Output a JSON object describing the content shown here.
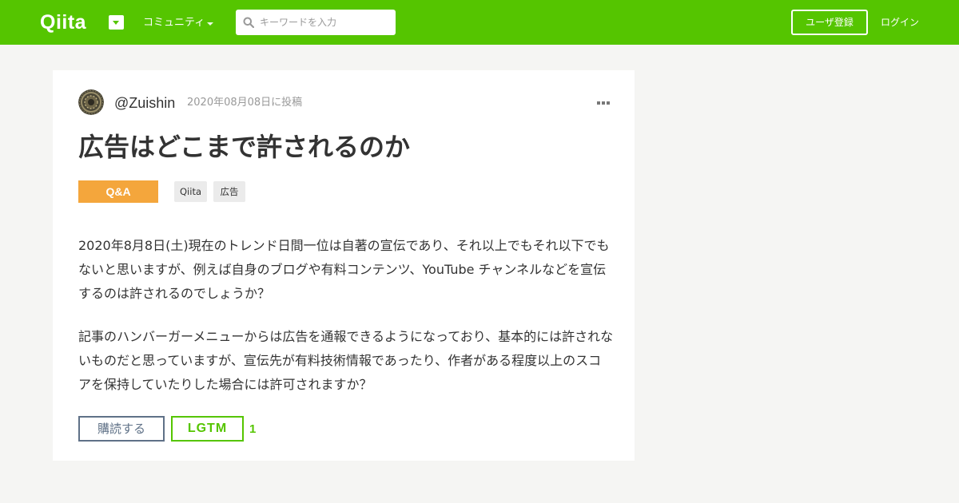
{
  "header": {
    "logo_text": "Qiita",
    "community_label": "コミュニティ",
    "search": {
      "placeholder": "キーワードを入力"
    },
    "signup_label": "ユーザ登録",
    "login_label": "ログイン"
  },
  "article": {
    "author": "@Zuishin",
    "posted_date": "2020年08月08日に投稿",
    "title": "広告はどこまで許されるのか",
    "badge": "Q&A",
    "tags": [
      "Qiita",
      "広告"
    ],
    "paragraphs": [
      "2020年8月8日(土)現在のトレンド日間一位は自著の宣伝であり、それ以上でもそれ以下でもないと思いますが、例えば自身のブログや有料コンテンツ、YouTube チャンネルなどを宣伝するのは許されるのでしょうか？",
      "記事のハンバーガーメニューからは広告を通報できるようになっており、基本的には許されないものだと思っていますが、宣伝先が有料技術情報であったり、作者がある程度以上のスコアを保持していたりした場合には許可されますか？"
    ],
    "subscribe_label": "購読する",
    "lgtm_label": "LGTM",
    "lgtm_count": "1"
  },
  "colors": {
    "brand_green": "#55c500",
    "qa_badge": "#f4a63c",
    "subscribe_border": "#5f7187",
    "page_background": "#f5f5f3"
  },
  "icons": {
    "logo_dropdown": "caret-down-icon",
    "search": "search-icon",
    "more": "ellipsis-icon",
    "avatar": "avatar"
  }
}
